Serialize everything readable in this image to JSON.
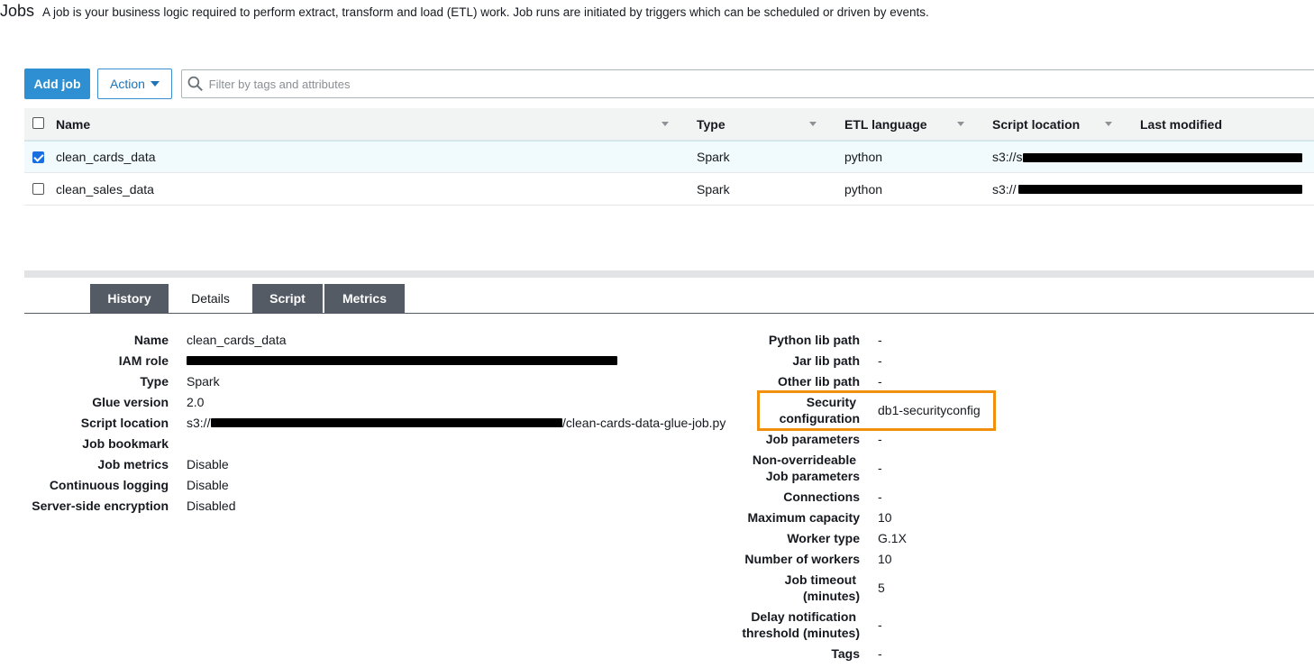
{
  "header": {
    "title": "Jobs",
    "description": "A job is your business logic required to perform extract, transform and load (ETL) work. Job runs are initiated by triggers which can be scheduled or driven by events."
  },
  "toolbar": {
    "add_job_label": "Add job",
    "action_label": "Action",
    "search_placeholder": "Filter by tags and attributes",
    "search_value": ""
  },
  "table": {
    "columns": [
      "Name",
      "Type",
      "ETL language",
      "Script location",
      "Last modified"
    ],
    "rows": [
      {
        "selected": true,
        "name": "clean_cards_data",
        "type": "Spark",
        "etl_language": "python",
        "script_location_prefix": "s3://s"
      },
      {
        "selected": false,
        "name": "clean_sales_data",
        "type": "Spark",
        "etl_language": "python",
        "script_location_prefix": "s3://"
      }
    ]
  },
  "tabs": [
    {
      "label": "History",
      "active": false
    },
    {
      "label": "Details",
      "active": true
    },
    {
      "label": "Script",
      "active": false
    },
    {
      "label": "Metrics",
      "active": false
    }
  ],
  "details_left": {
    "name": {
      "label": "Name",
      "value": "clean_cards_data"
    },
    "iam_role": {
      "label": "IAM role",
      "value": ""
    },
    "type": {
      "label": "Type",
      "value": "Spark"
    },
    "glue_version": {
      "label": "Glue version",
      "value": "2.0"
    },
    "script_location": {
      "label": "Script location",
      "value_prefix": "s3://",
      "value_suffix": "/clean-cards-data-glue-job.py"
    },
    "job_bookmark": {
      "label": "Job bookmark",
      "value": ""
    },
    "job_metrics": {
      "label": "Job metrics",
      "value": "Disable"
    },
    "continuous_logging": {
      "label": "Continuous logging",
      "value": "Disable"
    },
    "server_side_encryption": {
      "label": "Server-side encryption",
      "value": "Disabled"
    }
  },
  "details_right": {
    "python_lib_path": {
      "label": "Python lib path",
      "value": "-"
    },
    "jar_lib_path": {
      "label": "Jar lib path",
      "value": "-"
    },
    "other_lib_path": {
      "label": "Other lib path",
      "value": "-"
    },
    "security_configuration": {
      "label_line1": "Security",
      "label_line2": "configuration",
      "value": "db1-securityconfig"
    },
    "job_parameters": {
      "label": "Job parameters",
      "value": "-"
    },
    "non_overrideable_job_parameters": {
      "label_line1": "Non-overrideable",
      "label_line2": "Job parameters",
      "value": "-"
    },
    "connections": {
      "label": "Connections",
      "value": "-"
    },
    "maximum_capacity": {
      "label": "Maximum capacity",
      "value": "10"
    },
    "worker_type": {
      "label": "Worker type",
      "value": "G.1X"
    },
    "number_of_workers": {
      "label": "Number of workers",
      "value": "10"
    },
    "job_timeout": {
      "label_line1": "Job timeout",
      "label_line2": "(minutes)",
      "value": "5"
    },
    "delay_notification_threshold": {
      "label_line1": "Delay notification",
      "label_line2": "threshold (minutes)",
      "value": "-"
    },
    "tags": {
      "label": "Tags",
      "value": "-"
    }
  },
  "colors": {
    "primary_button": "#2e8fd2",
    "tab_inactive": "#545b64",
    "highlight_box": "#f0900e",
    "checkbox_checked": "#1a6fe0"
  }
}
